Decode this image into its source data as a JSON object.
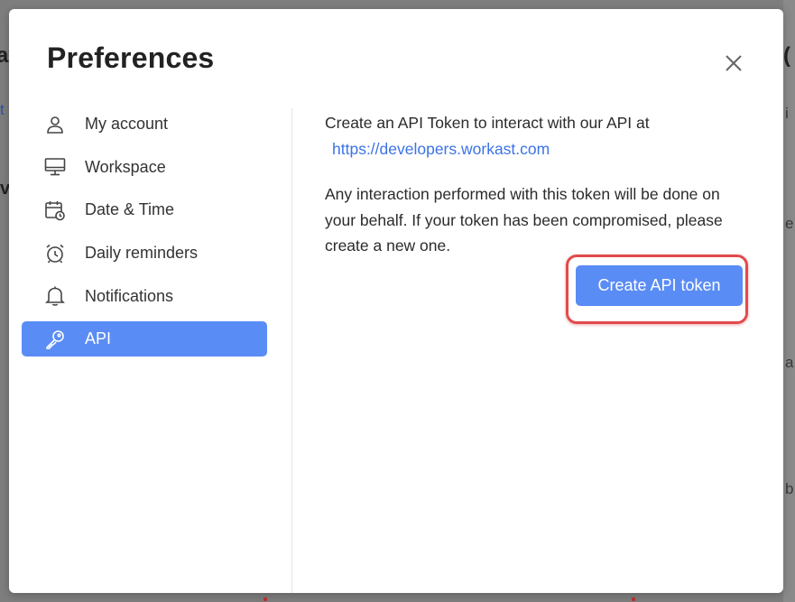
{
  "modal": {
    "title": "Preferences",
    "close_icon": "close-icon"
  },
  "sidebar": {
    "items": [
      {
        "label": "My account",
        "icon": "user-icon",
        "active": false
      },
      {
        "label": "Workspace",
        "icon": "monitor-icon",
        "active": false
      },
      {
        "label": "Date & Time",
        "icon": "calendar-clock-icon",
        "active": false
      },
      {
        "label": "Daily reminders",
        "icon": "alarm-clock-icon",
        "active": false
      },
      {
        "label": "Notifications",
        "icon": "bell-icon",
        "active": false
      },
      {
        "label": "API",
        "icon": "key-icon",
        "active": true
      }
    ]
  },
  "api": {
    "intro": "Create an API Token to interact with our API at",
    "link": "https://developers.workast.com",
    "warning": "Any interaction performed with this token will be done on your behalf. If your token has been compromised, please create a new one.",
    "create_label": "Create API token"
  },
  "colors": {
    "accent": "#5a8cf5",
    "link": "#3b73e6",
    "highlight": "#e14b4b"
  }
}
